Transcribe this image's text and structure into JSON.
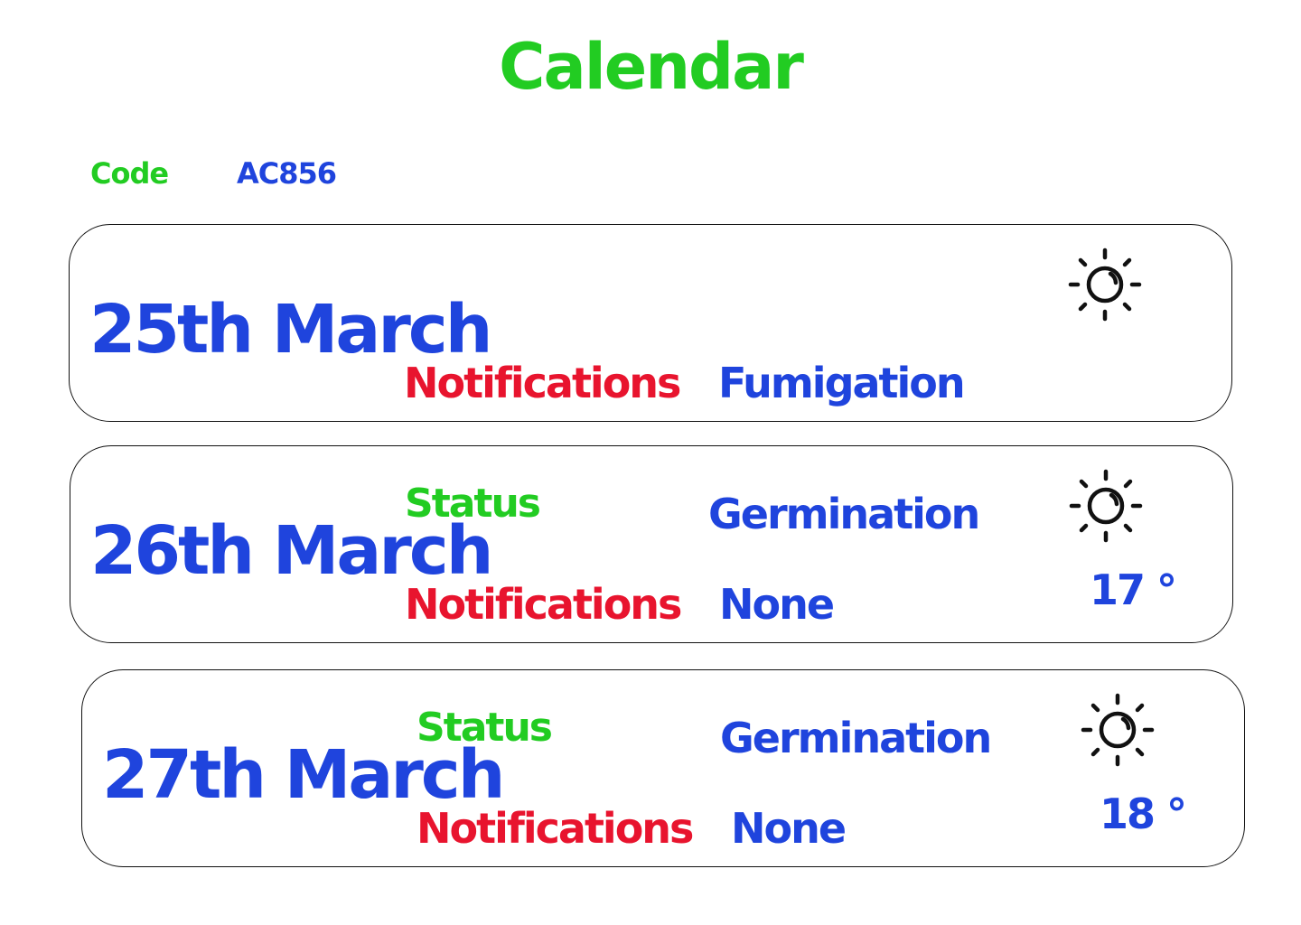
{
  "header": {
    "title": "Calendar",
    "code_label": "Code",
    "code_value": "AC856"
  },
  "colors": {
    "primary_blue": "#1f44dd",
    "accent_green": "#22cc22",
    "alert_red": "#e8142e",
    "border": "#111111"
  },
  "days": [
    {
      "date": "25th March",
      "weather_icon": "sun-icon",
      "notifications_label": "Notifications",
      "notifications_value": "Fumigation"
    },
    {
      "date": "26th March",
      "weather_icon": "sun-icon",
      "status_label": "Status",
      "status_value": "Germination",
      "notifications_label": "Notifications",
      "notifications_value": "None",
      "temperature": "17 °"
    },
    {
      "date": "27th March",
      "weather_icon": "sun-icon",
      "status_label": "Status",
      "status_value": "Germination",
      "notifications_label": "Notifications",
      "notifications_value": "None",
      "temperature": "18 °"
    }
  ]
}
